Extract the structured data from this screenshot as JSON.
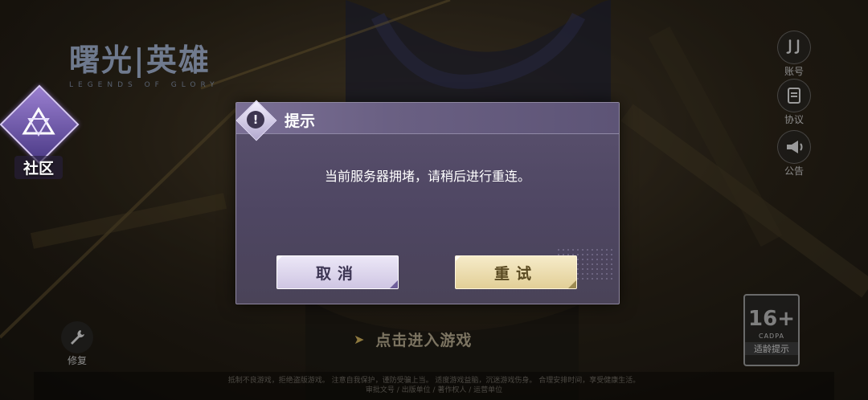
{
  "logo": {
    "title": "曙光|英雄",
    "subtitle": "LEGENDS OF GLORY"
  },
  "community": {
    "label": "社区",
    "icon": "community-triangle-icon"
  },
  "side_buttons": [
    {
      "label": "账号",
      "icon": "account-icon"
    },
    {
      "label": "协议",
      "icon": "agreement-icon"
    },
    {
      "label": "公告",
      "icon": "announcement-icon"
    }
  ],
  "repair": {
    "label": "修复",
    "icon": "wrench-icon"
  },
  "age_rating": {
    "number": "16+",
    "org": "CADPA",
    "tip": "适龄提示"
  },
  "enter_game": {
    "label": "点击进入游戏",
    "icon": "arrow-right-icon"
  },
  "footer": {
    "line1": "抵制不良游戏，拒绝盗版游戏。 注意自我保护，谨防受骗上当。 适度游戏益脑，沉迷游戏伤身。 合理安排时间，享受健康生活。",
    "line2": "审批文号 / 出版单位 / 著作权人 / 运营单位"
  },
  "dialog": {
    "title": "提示",
    "message": "当前服务器拥堵，请稍后进行重连。",
    "cancel_label": "取消",
    "retry_label": "重试"
  },
  "colors": {
    "dialog_bg": "#524a66",
    "cancel_bg": "#dcd5ec",
    "retry_bg": "#eedfb0"
  }
}
